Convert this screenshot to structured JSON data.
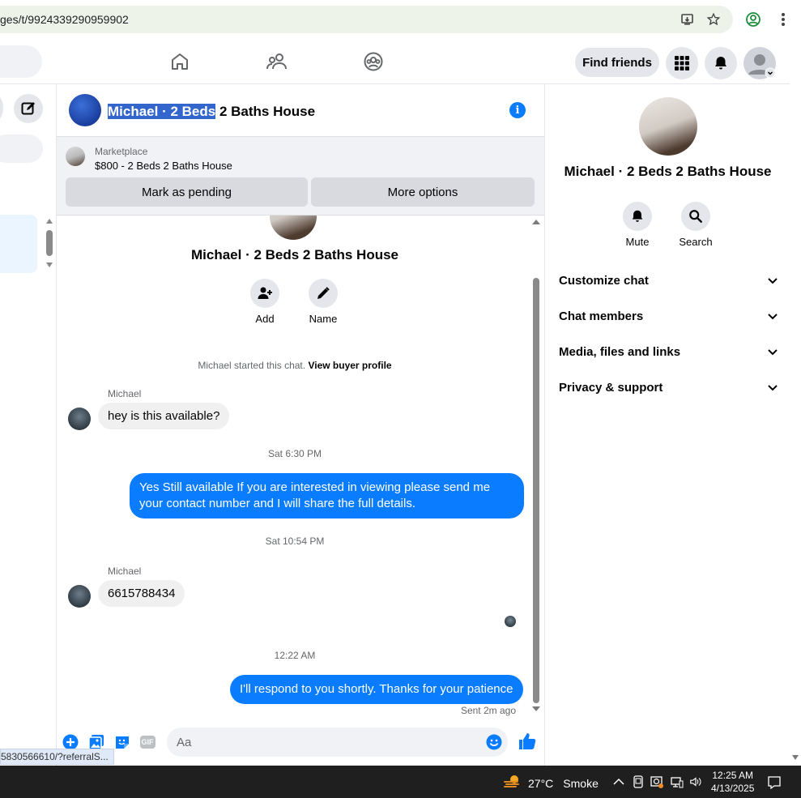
{
  "browser": {
    "url": "ges/t/9924339290959902"
  },
  "nav": {
    "find_friends_label": "Find friends"
  },
  "chat": {
    "title_selected": "Michael · 2 Beds",
    "title_rest": " 2 Baths House",
    "marketplace_label": "Marketplace",
    "listing": "$800 - 2 Beds 2 Baths House",
    "mark_pending_label": "Mark as pending",
    "more_options_label": "More options",
    "conversation_title": "Michael · 2 Beds 2 Baths House",
    "actions": [
      {
        "label": "Add"
      },
      {
        "label": "Name"
      }
    ],
    "system_text": "Michael started this chat.",
    "system_link": "View buyer profile",
    "messages": [
      {
        "sender": "Michael",
        "text": "hey is this available?"
      },
      {
        "timestamp": "Sat 6:30 PM"
      },
      {
        "text": "Yes Still available If you are interested in viewing please send me your contact number and I will share the full details."
      },
      {
        "timestamp": "Sat 10:54 PM"
      },
      {
        "sender": "Michael",
        "text": "6615788434"
      },
      {
        "timestamp": "12:22 AM"
      },
      {
        "text": "I'll respond to you shortly. Thanks for your patience"
      }
    ],
    "sent_status": "Sent 2m ago",
    "composer_placeholder": "Aa",
    "gif_label": "GIF"
  },
  "status_url": "5830566610/?referralS...",
  "info_panel": {
    "title": "Michael · 2 Beds 2 Baths House",
    "actions": [
      {
        "label": "Mute"
      },
      {
        "label": "Search"
      }
    ],
    "sections": [
      {
        "label": "Customize chat"
      },
      {
        "label": "Chat members"
      },
      {
        "label": "Media, files and links"
      },
      {
        "label": "Privacy & support"
      }
    ]
  },
  "taskbar": {
    "temperature": "27°C",
    "weather": "Smoke",
    "time": "12:25 AM",
    "date": "4/13/2025"
  },
  "colors": {
    "accent": "#0a7cff",
    "selection": "#3366cc"
  }
}
